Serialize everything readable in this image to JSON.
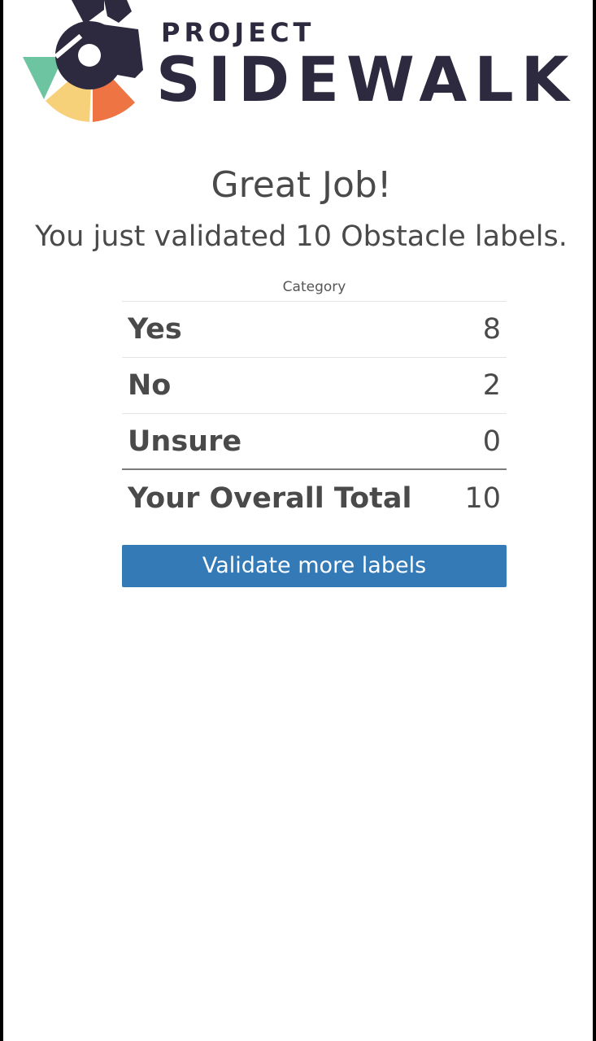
{
  "logo": {
    "line1": "PROJECT",
    "line2": "SIDEWALK",
    "icon": "wheelchair-icon",
    "colors": {
      "dark": "#2d2a3f",
      "teal": "#6cc4a1",
      "yellow": "#f7d07a",
      "orange": "#ee7443"
    }
  },
  "summary": {
    "headline": "Great Job!",
    "message": "You just validated 10 Obstacle labels."
  },
  "table": {
    "header": "Category",
    "rows": [
      {
        "label": "Yes",
        "value": "8"
      },
      {
        "label": "No",
        "value": "2"
      },
      {
        "label": "Unsure",
        "value": "0"
      }
    ],
    "total_label": "Your Overall Total",
    "total_value": "10"
  },
  "actions": {
    "validate_more": "Validate more labels"
  },
  "colors": {
    "button": "#337ab7",
    "text": "#4a4a4a"
  }
}
